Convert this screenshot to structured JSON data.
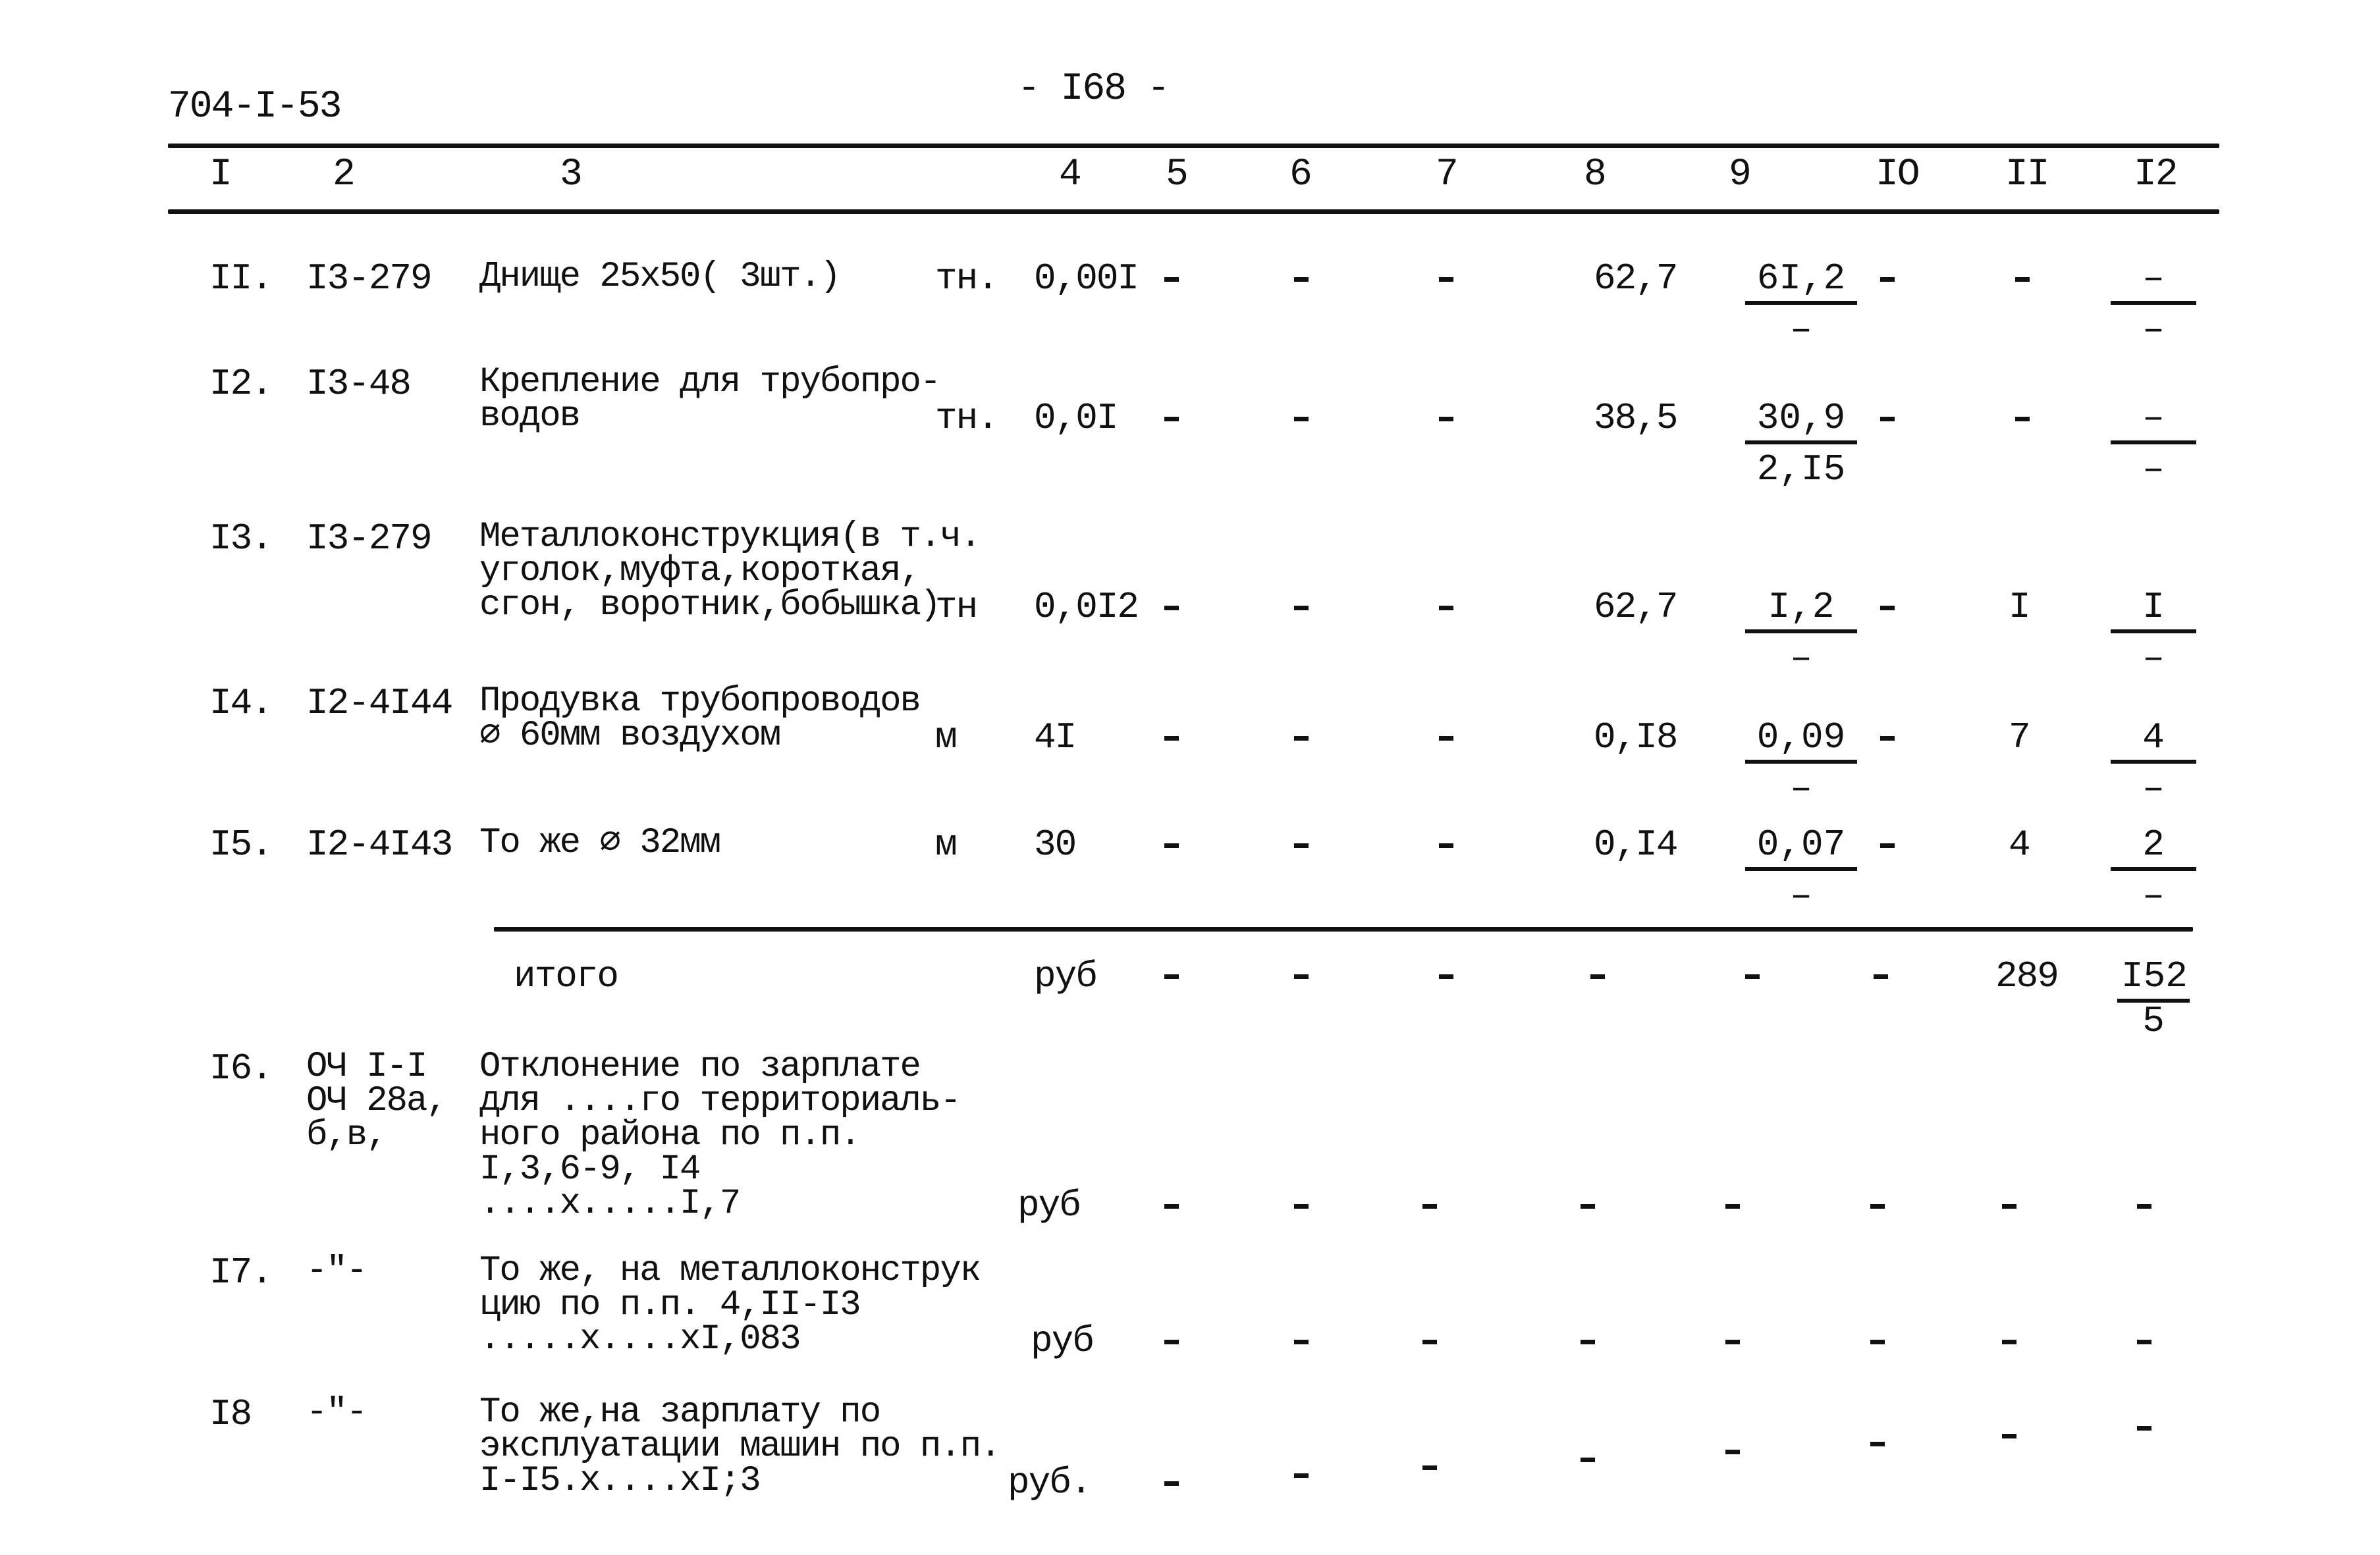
{
  "doc": {
    "code": "704-I-53",
    "page": "- I68 -"
  },
  "columns": [
    "I",
    "2",
    "3",
    "4",
    "5",
    "6",
    "7",
    "8",
    "9",
    "IO",
    "II",
    "I2"
  ],
  "rows": [
    {
      "no": "II.",
      "code": "I3-279",
      "desc": "Днище 25х50( 3шт.)",
      "unit": "тн.",
      "qty": "0,00I",
      "c5": "-",
      "c6": "-",
      "c7": "-",
      "c8": "62,7",
      "c9_num": "6I,2",
      "c9_den": "-",
      "c10": "-",
      "c11": "-",
      "c12_num": "-",
      "c12_den": "-"
    },
    {
      "no": "I2.",
      "code": "I3-48",
      "desc": "Крепление для трубопро-\nводов",
      "unit": "тн.",
      "qty": "0,0I",
      "c5": "-",
      "c6": "-",
      "c7": "-",
      "c8": "38,5",
      "c9_num": "30,9",
      "c9_den": "2,I5",
      "c10": "-",
      "c11": "-",
      "c12_num": "-",
      "c12_den": "-"
    },
    {
      "no": "I3.",
      "code": "I3-279",
      "desc": "Металлоконструкция(в т.ч.\nуголок,муфта,короткая,\nсгон, воротник,бобышка)",
      "unit": "тн",
      "qty": "0,0I2",
      "c5": "-",
      "c6": "-",
      "c7": "-",
      "c8": "62,7",
      "c9_num": "I,2",
      "c9_den": "-",
      "c10": "-",
      "c11": "I",
      "c12_num": "I",
      "c12_den": "-"
    },
    {
      "no": "I4.",
      "code": "I2-4I44",
      "desc": "Продувка трубопроводов\n∅ 60мм воздухом",
      "unit": "м",
      "qty": "4I",
      "c5": "-",
      "c6": "-",
      "c7": "-",
      "c8": "0,I8",
      "c9_num": "0,09",
      "c9_den": "-",
      "c10": "-",
      "c11": "7",
      "c12_num": "4",
      "c12_den": "-"
    },
    {
      "no": "I5.",
      "code": "I2-4I43",
      "desc": "То же ∅ 32мм",
      "unit": "м",
      "qty": "30",
      "c5": "-",
      "c6": "-",
      "c7": "-",
      "c8": "0,I4",
      "c9_num": "0,07",
      "c9_den": "-",
      "c10": "-",
      "c11": "4",
      "c12_num": "2",
      "c12_den": "-"
    }
  ],
  "total": {
    "label": "итого",
    "unit": "руб",
    "c5": "-",
    "c6": "-",
    "c7": "-",
    "c8": "-",
    "c9": "-",
    "c10": "-",
    "c11": "289",
    "c12_num": "I52",
    "c12_den": "5"
  },
  "extra_rows": [
    {
      "no": "I6.",
      "code": "ОЧ I-I\nОЧ 28а,\nб,в,",
      "desc": "Отклонение по зарплате\nдля ....го территориаль-\nного района по п.п.\nI,3,6-9, I4\n....х.....I,7",
      "unit": "руб",
      "cells": [
        "-",
        "-",
        "-",
        "-",
        "-",
        "-",
        "-",
        "-"
      ]
    },
    {
      "no": "I7.",
      "code": "-\"-",
      "desc": "То же, на металлоконструк\nцию по п.п. 4,II-I3\n.....х....хI,083",
      "unit": "руб",
      "cells": [
        "-",
        "-",
        "-",
        "-",
        "-",
        "-",
        "-",
        "-"
      ]
    },
    {
      "no": "I8",
      "code": "-\"-",
      "desc": "То же,на зарплату по\nэксплуатации машин по п.п.\nI-I5.х....хI;3",
      "unit": "руб.",
      "cells": [
        "-",
        "-",
        "-",
        "-",
        "-",
        "-",
        "-",
        "-"
      ]
    }
  ]
}
